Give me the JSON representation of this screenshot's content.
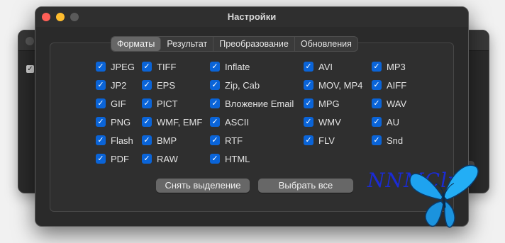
{
  "window": {
    "title": "Настройки"
  },
  "tabs": [
    {
      "label": "Форматы",
      "active": true
    },
    {
      "label": "Результат",
      "active": false
    },
    {
      "label": "Преобразование",
      "active": false
    },
    {
      "label": "Обновления",
      "active": false
    }
  ],
  "formats": {
    "col1": [
      {
        "label": "JPEG",
        "checked": true
      },
      {
        "label": "JP2",
        "checked": true
      },
      {
        "label": "GIF",
        "checked": true
      },
      {
        "label": "PNG",
        "checked": true
      },
      {
        "label": "Flash",
        "checked": true
      },
      {
        "label": "PDF",
        "checked": true
      }
    ],
    "col2": [
      {
        "label": "TIFF",
        "checked": true
      },
      {
        "label": "EPS",
        "checked": true
      },
      {
        "label": "PICT",
        "checked": true
      },
      {
        "label": "WMF, EMF",
        "checked": true
      },
      {
        "label": "BMP",
        "checked": true
      },
      {
        "label": "RAW",
        "checked": true
      }
    ],
    "col3": [
      {
        "label": "Inflate",
        "checked": true
      },
      {
        "label": "Zip, Cab",
        "checked": true
      },
      {
        "label": "Вложение Email",
        "checked": true
      },
      {
        "label": "ASCII",
        "checked": true
      },
      {
        "label": "RTF",
        "checked": true
      },
      {
        "label": "HTML",
        "checked": true
      }
    ],
    "col4": [
      {
        "label": "AVI",
        "checked": true
      },
      {
        "label": "MOV, MP4",
        "checked": true
      },
      {
        "label": "MPG",
        "checked": true
      },
      {
        "label": "WMV",
        "checked": true
      },
      {
        "label": "FLV",
        "checked": true
      }
    ],
    "col5": [
      {
        "label": "MP3",
        "checked": true
      },
      {
        "label": "AIFF",
        "checked": true
      },
      {
        "label": "WAV",
        "checked": true
      },
      {
        "label": "AU",
        "checked": true
      },
      {
        "label": "Snd",
        "checked": true
      }
    ]
  },
  "buttons": {
    "deselect": "Снять выделение",
    "select_all": "Выбрать все"
  },
  "watermark": {
    "text": "NNMClub",
    "icon": "butterfly-icon"
  },
  "colors": {
    "checkbox_accent": "#0a64d8",
    "close": "#ff5f57",
    "minimize": "#febc2e",
    "watermark_text": "#1a2bd6",
    "butterfly": "#1ea3f0"
  }
}
